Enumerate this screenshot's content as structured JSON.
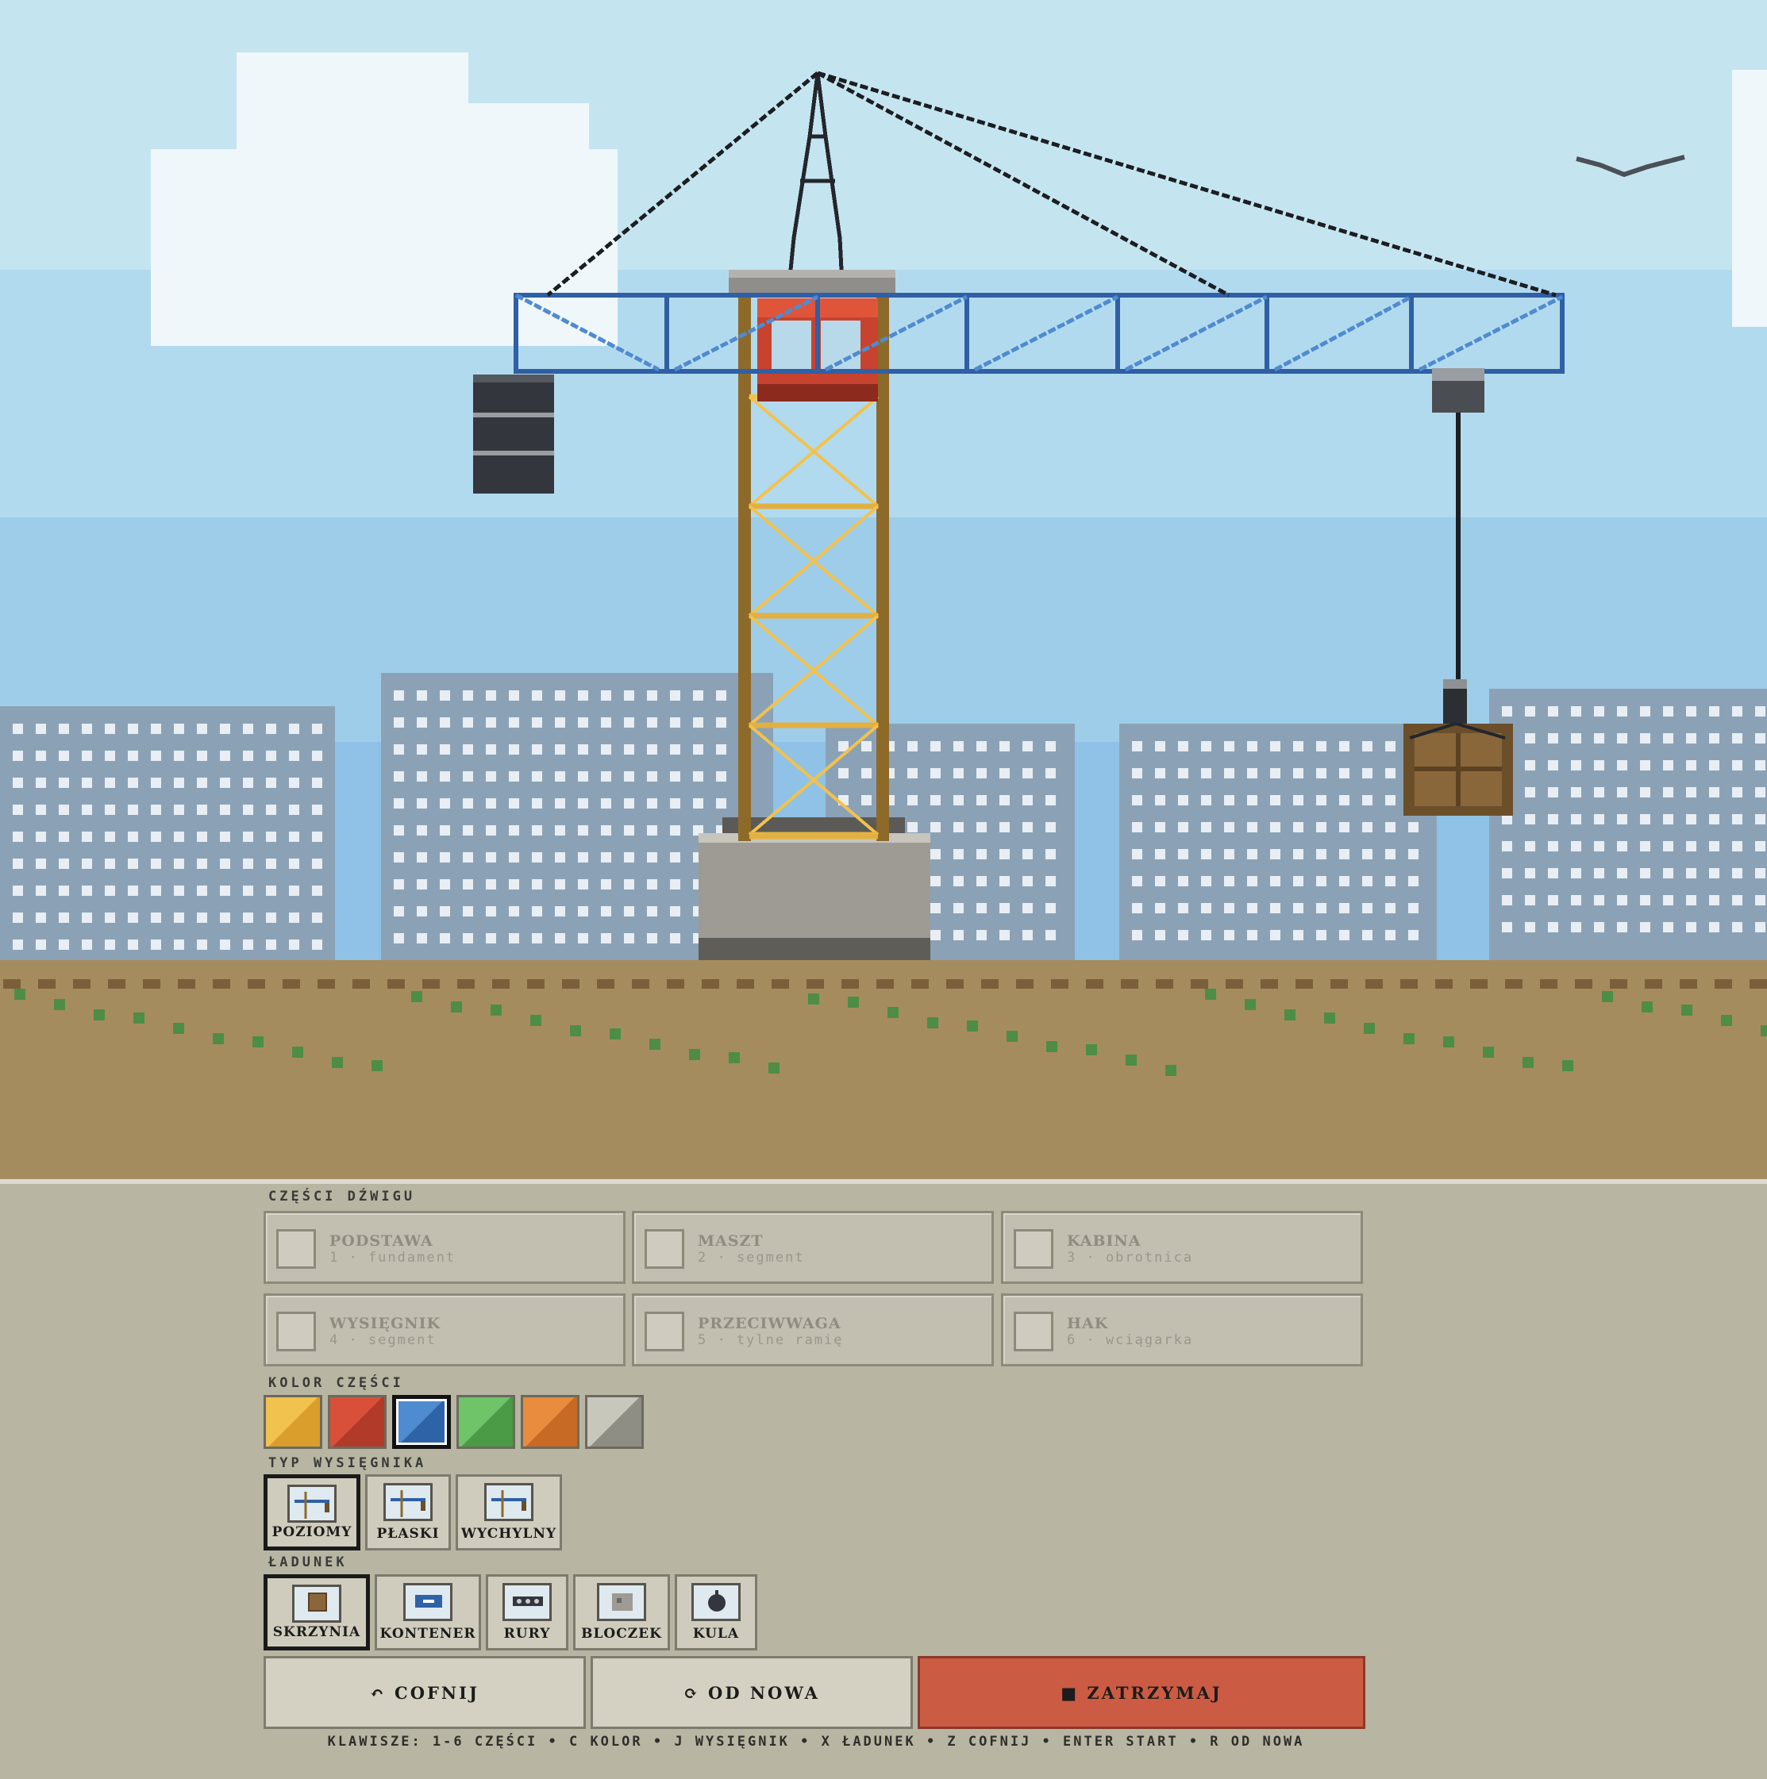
{
  "panel": {
    "parts_label": "CZĘŚCI DŹWIGU",
    "parts": [
      {
        "name": "PODSTAWA",
        "sub": "1 · fundament",
        "icon": "base-icon"
      },
      {
        "name": "MASZT",
        "sub": "2 · segment",
        "icon": "mast-icon"
      },
      {
        "name": "KABINA",
        "sub": "3 · obrotnica",
        "icon": "cabin-icon"
      },
      {
        "name": "WYSIĘGNIK",
        "sub": "4 · segment",
        "icon": "jib-icon"
      },
      {
        "name": "PRZECIWWAGA",
        "sub": "5 · tylne ramię",
        "icon": "counterweight-icon"
      },
      {
        "name": "HAK",
        "sub": "6 · wciągarka",
        "icon": "hook-icon"
      }
    ],
    "color_label": "KOLOR CZĘŚCI",
    "colors": [
      {
        "name": "yellow",
        "c1": "#f2c24e",
        "c2": "#d99e2c",
        "selected": false
      },
      {
        "name": "red",
        "c1": "#d9503a",
        "c2": "#b13a28",
        "selected": false
      },
      {
        "name": "blue",
        "c1": "#4f8bd1",
        "c2": "#2f63a8",
        "selected": true
      },
      {
        "name": "green",
        "c1": "#6fc46a",
        "c2": "#4a9a46",
        "selected": false
      },
      {
        "name": "orange",
        "c1": "#e88d3e",
        "c2": "#c66a26",
        "selected": false
      },
      {
        "name": "gray",
        "c1": "#c8c7bc",
        "c2": "#8f8e84",
        "selected": false
      }
    ],
    "jib_label": "TYP WYSIĘGNIKA",
    "jib_types": [
      {
        "label": "POZIOMY",
        "selected": true
      },
      {
        "label": "PŁASKI",
        "selected": false
      },
      {
        "label": "WYCHYLNY",
        "selected": false
      }
    ],
    "load_label": "ŁADUNEK",
    "loads": [
      {
        "label": "SKRZYNIA",
        "selected": true
      },
      {
        "label": "KONTENER",
        "selected": false
      },
      {
        "label": "RURY",
        "selected": false
      },
      {
        "label": "BLOCZEK",
        "selected": false
      },
      {
        "label": "KULA",
        "selected": false
      }
    ],
    "actions": {
      "undo": "↶ COFNIJ",
      "reset": "⟳ OD NOWA",
      "stop": "■ ZATRZYMAJ"
    },
    "keys_hint": "KLAWISZE: 1-6 CZĘŚCI  •  C KOLOR  •  J WYSIĘGNIK  •  X ŁADUNEK  •  Z COFNIJ  •  ENTER START  •  R OD NOWA"
  },
  "scene": {
    "sky_colors": [
      "#c4e4f0",
      "#aed8ee",
      "#9ccbe8",
      "#8fc2e6"
    ],
    "ground_color": "#a58c5e",
    "building_color": "#8aa2b7",
    "jib_color": "#2f5fa5",
    "mast_color": "#f2c24e",
    "cabin_color": "#d9503a",
    "load": "crate"
  }
}
